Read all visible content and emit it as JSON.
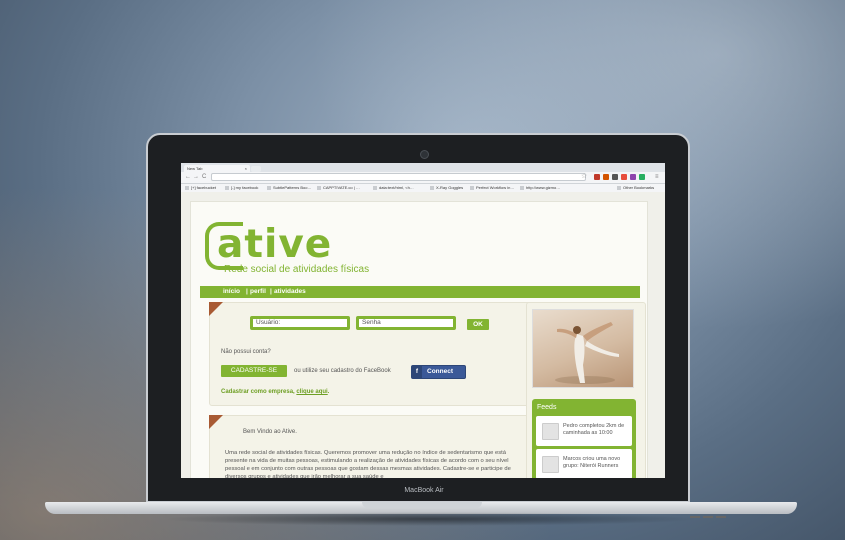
{
  "browser": {
    "tab_title": "New Tab",
    "tab_close": "×",
    "nav_back": "←",
    "nav_forward": "→",
    "nav_reload": "C",
    "url": "",
    "bookmarks": [
      "[+] facebucket",
      "[-] my facebook",
      "SubtlePatterns Boo…",
      "CAPPTIVATE.co | …",
      "data:text/html, <h…",
      "X-Ray Goggles",
      "Perfect Workflow in…",
      "http://www.gizmo…"
    ],
    "other_bookmarks": "Other Bookmarks"
  },
  "site": {
    "logo": "ative",
    "tagline": "Rede social de atividades físicas",
    "menu": [
      "início",
      "perfil",
      "atividades"
    ],
    "menu_sep": "|",
    "login": {
      "user_placeholder": "Usuário:",
      "pass_placeholder": "Senha",
      "ok_label": "OK",
      "no_account": "Não possui conta?",
      "signup_label": "CADASTRE-SE",
      "or_text": "ou utilize seu cadastro do FaceBook",
      "fb_icon": "f",
      "fb_label": "Connect",
      "company_text": "Cadastrar como empresa,",
      "company_link": "clique aqui",
      "company_end": "."
    },
    "welcome": {
      "title": "Bem Vindo ao Ative.",
      "body": "Uma rede social de atividades físicas. Queremos promover uma redução no índice de sedentarismo que está presente na vida de muitas pessoas, estimulando a realização de atividades físicas de acordo com o seu nível pessoal e em conjunto com outras pessoas que gostam dessas mesmas atividades. Cadastre-se e participe de diversos grupos e atividades que irão melhorar a sua saúde e"
    },
    "feeds": {
      "title": "Feeds",
      "items": [
        {
          "text": "Pedro completou 2km de caminhada as 10:00"
        },
        {
          "text": "Marcos criou uma novo grupo: Niterói Runners"
        }
      ]
    }
  },
  "device": {
    "label": "MacBook Air"
  },
  "colors": {
    "accent": "#82b432",
    "corner": "#a85a33",
    "facebook": "#3b5998"
  }
}
